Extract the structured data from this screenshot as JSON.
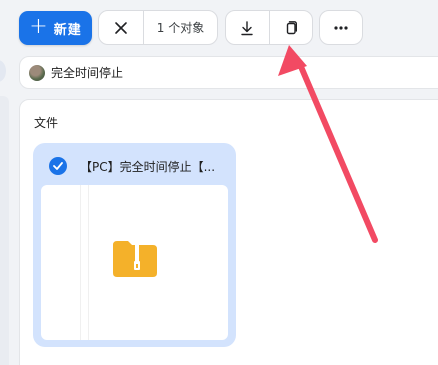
{
  "toolbar": {
    "new_label": "新建",
    "selection_count": "1 个对象"
  },
  "breadcrumb": {
    "folder_name": "完全时间停止"
  },
  "content": {
    "section_title": "文件",
    "files": [
      {
        "name": "【PC】完全时间停止【...",
        "selected": true,
        "icon": "zip-folder-icon"
      }
    ]
  },
  "colors": {
    "accent": "#1a73e8",
    "selected_card": "#d3e3fd",
    "zip_icon": "#f4b12a",
    "annotation_arrow": "#f24a63"
  }
}
